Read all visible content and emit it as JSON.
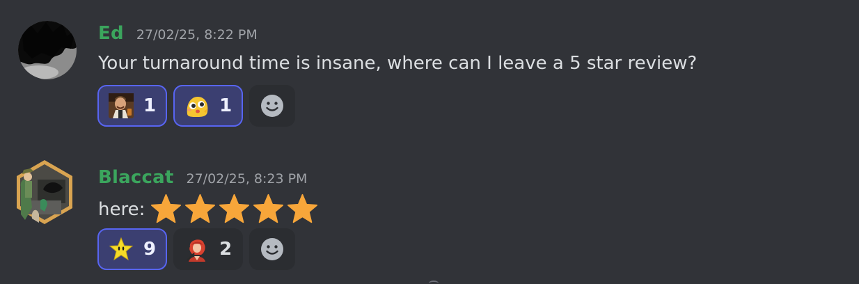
{
  "messages": [
    {
      "username": "Ed",
      "timestamp": "27/02/25, 8:22 PM",
      "text": "Your turnaround time is insane, where can I leave a 5 star review?",
      "name_color": "#3ba55d",
      "avatar_icon": "dark-silhouette-avatar",
      "reactions": [
        {
          "emoji": "laughing-man-emoji",
          "count": "1",
          "reacted_by_me": true
        },
        {
          "emoji": "excited-blob-emoji",
          "count": "1",
          "reacted_by_me": true
        }
      ]
    },
    {
      "username": "Blaccat",
      "timestamp": "27/02/25, 8:23 PM",
      "text": "here:",
      "stars": 5,
      "name_color": "#3ba55d",
      "avatar_icon": "hexagon-frame-avatar",
      "reactions": [
        {
          "emoji": "star-face-emoji",
          "count": "9",
          "reacted_by_me": true
        },
        {
          "emoji": "red-hair-character-emoji",
          "count": "2",
          "reacted_by_me": false
        }
      ]
    }
  ],
  "add_reaction_icon": "smiley-add-reaction-icon",
  "colors": {
    "background": "#313338",
    "reaction_bg": "#2b2d31",
    "reaction_me_bg": "#3b3f71",
    "reaction_me_border": "#5865f2",
    "text": "#dbdee1",
    "timestamp": "#a0a3a8",
    "star": "#f7a63a"
  }
}
